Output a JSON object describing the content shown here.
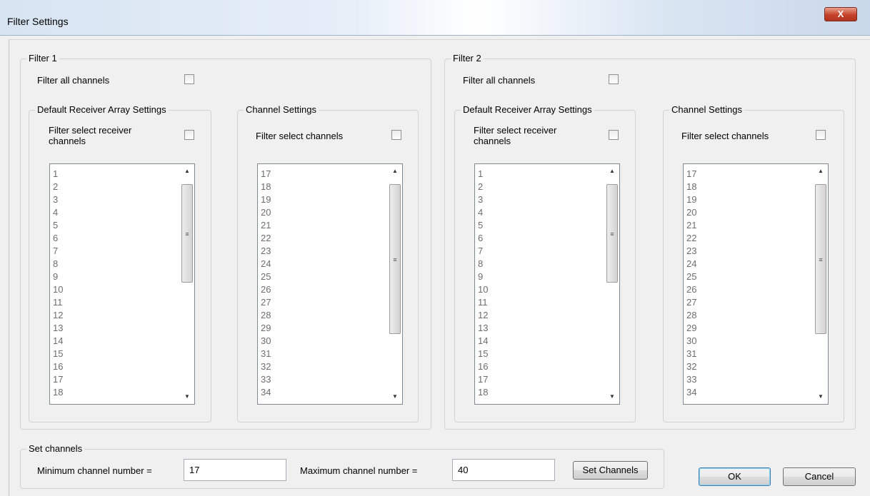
{
  "window": {
    "title": "Filter Settings",
    "close_label": "X"
  },
  "filters": [
    {
      "legend": "Filter 1",
      "filter_all_label": "Filter all channels",
      "receiver_group": {
        "legend": "Default Receiver Array Settings",
        "checkbox_label": "Filter select receiver channels",
        "items": [
          "1",
          "2",
          "3",
          "4",
          "5",
          "6",
          "7",
          "8",
          "9",
          "10",
          "11",
          "12",
          "13",
          "14",
          "15",
          "16",
          "17",
          "18"
        ]
      },
      "channel_group": {
        "legend": "Channel Settings",
        "checkbox_label": "Filter select channels",
        "items": [
          "17",
          "18",
          "19",
          "20",
          "21",
          "22",
          "23",
          "24",
          "25",
          "26",
          "27",
          "28",
          "29",
          "30",
          "31",
          "32",
          "33",
          "34"
        ]
      }
    },
    {
      "legend": "Filter 2",
      "filter_all_label": "Filter all channels",
      "receiver_group": {
        "legend": "Default Receiver Array Settings",
        "checkbox_label": "Filter select receiver channels",
        "items": [
          "1",
          "2",
          "3",
          "4",
          "5",
          "6",
          "7",
          "8",
          "9",
          "10",
          "11",
          "12",
          "13",
          "14",
          "15",
          "16",
          "17",
          "18"
        ]
      },
      "channel_group": {
        "legend": "Channel Settings",
        "checkbox_label": "Filter select channels",
        "items": [
          "17",
          "18",
          "19",
          "20",
          "21",
          "22",
          "23",
          "24",
          "25",
          "26",
          "27",
          "28",
          "29",
          "30",
          "31",
          "32",
          "33",
          "34"
        ]
      }
    }
  ],
  "set_channels": {
    "legend": "Set channels",
    "min_label": "Minimum channel number =",
    "min_value": "17",
    "max_label": "Maximum channel number =",
    "max_value": "40",
    "button_label": "Set Channels"
  },
  "buttons": {
    "ok": "OK",
    "cancel": "Cancel"
  }
}
